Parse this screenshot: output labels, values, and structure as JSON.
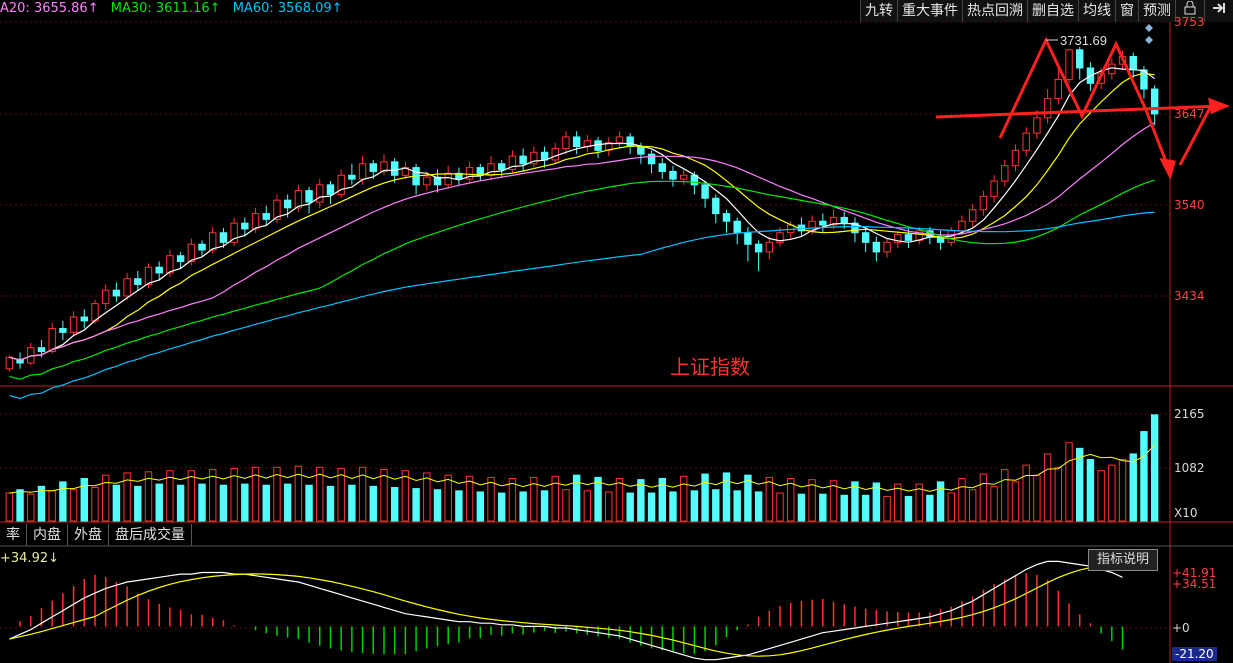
{
  "ma_legend": {
    "ma20": "A20: 3655.86↑",
    "ma30": "MA30: 3611.16↑",
    "ma60": "MA60: 3568.09↑"
  },
  "toolbar": {
    "items": [
      "九转",
      "重大事件",
      "热点回溯",
      "删自选",
      "均线",
      "窗",
      "预测"
    ]
  },
  "title": "上证指数",
  "peak_label": "3731.69",
  "tabs": [
    "率",
    "内盘",
    "外盘",
    "盘后成交量"
  ],
  "macd_value": "+34.92↓",
  "indicator_button": "指标说明",
  "axes": {
    "price_ticks": [
      "3753",
      "3647",
      "3540",
      "3434"
    ],
    "volume_ticks": [
      "2165",
      "1082",
      "X10"
    ],
    "macd_ticks": [
      "+41.91",
      "+34.51",
      "+0",
      "-21.20"
    ]
  },
  "colors": {
    "up": "#ff3232",
    "down": "#54fcfc",
    "ma5": "#ffffff",
    "ma10": "#ffff00",
    "ma20": "#ff80ff",
    "ma30": "#00e600",
    "ma60": "#00c0ff"
  },
  "chart_data": {
    "type": "candlestick",
    "y_range": [
      3380,
      3760
    ],
    "volume_range": [
      0,
      2165
    ],
    "macd_range": [
      -21.2,
      41.91
    ],
    "candles": [
      [
        3398,
        3410,
        3395,
        3412
      ],
      [
        3408,
        3404,
        3398,
        3415
      ],
      [
        3404,
        3420,
        3402,
        3425
      ],
      [
        3420,
        3416,
        3410,
        3428
      ],
      [
        3416,
        3440,
        3414,
        3446
      ],
      [
        3440,
        3436,
        3428,
        3448
      ],
      [
        3436,
        3452,
        3432,
        3458
      ],
      [
        3452,
        3448,
        3440,
        3460
      ],
      [
        3448,
        3466,
        3445,
        3470
      ],
      [
        3466,
        3480,
        3460,
        3486
      ],
      [
        3480,
        3474,
        3468,
        3488
      ],
      [
        3474,
        3492,
        3470,
        3498
      ],
      [
        3492,
        3486,
        3480,
        3500
      ],
      [
        3486,
        3504,
        3482,
        3508
      ],
      [
        3504,
        3498,
        3490,
        3510
      ],
      [
        3498,
        3516,
        3494,
        3522
      ],
      [
        3516,
        3510,
        3502,
        3520
      ],
      [
        3510,
        3528,
        3506,
        3534
      ],
      [
        3528,
        3522,
        3516,
        3532
      ],
      [
        3522,
        3540,
        3518,
        3546
      ],
      [
        3540,
        3530,
        3524,
        3545
      ],
      [
        3530,
        3550,
        3526,
        3556
      ],
      [
        3550,
        3544,
        3536,
        3556
      ],
      [
        3544,
        3560,
        3540,
        3566
      ],
      [
        3560,
        3554,
        3548,
        3568
      ],
      [
        3554,
        3574,
        3550,
        3580
      ],
      [
        3574,
        3566,
        3556,
        3580
      ],
      [
        3566,
        3584,
        3562,
        3590
      ],
      [
        3584,
        3572,
        3560,
        3588
      ],
      [
        3572,
        3590,
        3566,
        3596
      ],
      [
        3590,
        3580,
        3570,
        3594
      ],
      [
        3580,
        3600,
        3576,
        3606
      ],
      [
        3600,
        3596,
        3590,
        3612
      ],
      [
        3596,
        3612,
        3590,
        3620
      ],
      [
        3612,
        3604,
        3596,
        3616
      ],
      [
        3604,
        3614,
        3600,
        3622
      ],
      [
        3614,
        3600,
        3592,
        3618
      ],
      [
        3600,
        3608,
        3596,
        3614
      ],
      [
        3608,
        3590,
        3580,
        3612
      ],
      [
        3590,
        3598,
        3584,
        3604
      ],
      [
        3598,
        3590,
        3582,
        3606
      ],
      [
        3590,
        3602,
        3586,
        3610
      ],
      [
        3602,
        3596,
        3590,
        3608
      ],
      [
        3596,
        3608,
        3592,
        3614
      ],
      [
        3608,
        3600,
        3594,
        3612
      ],
      [
        3600,
        3612,
        3596,
        3620
      ],
      [
        3612,
        3606,
        3598,
        3616
      ],
      [
        3606,
        3620,
        3602,
        3626
      ],
      [
        3620,
        3612,
        3604,
        3628
      ],
      [
        3612,
        3624,
        3608,
        3630
      ],
      [
        3624,
        3616,
        3608,
        3630
      ],
      [
        3616,
        3628,
        3612,
        3634
      ],
      [
        3628,
        3640,
        3622,
        3646
      ],
      [
        3640,
        3630,
        3622,
        3646
      ],
      [
        3630,
        3636,
        3624,
        3642
      ],
      [
        3636,
        3626,
        3618,
        3640
      ],
      [
        3626,
        3634,
        3620,
        3640
      ],
      [
        3634,
        3640,
        3628,
        3646
      ],
      [
        3640,
        3630,
        3622,
        3644
      ],
      [
        3630,
        3622,
        3612,
        3634
      ],
      [
        3622,
        3612,
        3602,
        3626
      ],
      [
        3612,
        3604,
        3596,
        3618
      ],
      [
        3604,
        3596,
        3588,
        3610
      ],
      [
        3596,
        3600,
        3590,
        3606
      ],
      [
        3600,
        3590,
        3580,
        3604
      ],
      [
        3590,
        3576,
        3566,
        3594
      ],
      [
        3576,
        3560,
        3550,
        3580
      ],
      [
        3560,
        3552,
        3540,
        3564
      ],
      [
        3552,
        3540,
        3528,
        3556
      ],
      [
        3540,
        3528,
        3510,
        3546
      ],
      [
        3528,
        3520,
        3500,
        3532
      ],
      [
        3520,
        3530,
        3512,
        3536
      ],
      [
        3530,
        3540,
        3526,
        3546
      ],
      [
        3540,
        3548,
        3534,
        3552
      ],
      [
        3548,
        3542,
        3536,
        3556
      ],
      [
        3542,
        3552,
        3538,
        3558
      ],
      [
        3552,
        3548,
        3540,
        3560
      ],
      [
        3548,
        3556,
        3544,
        3564
      ],
      [
        3556,
        3550,
        3544,
        3562
      ],
      [
        3550,
        3540,
        3530,
        3556
      ],
      [
        3540,
        3530,
        3520,
        3546
      ],
      [
        3530,
        3520,
        3510,
        3536
      ],
      [
        3520,
        3530,
        3514,
        3534
      ],
      [
        3530,
        3538,
        3524,
        3542
      ],
      [
        3538,
        3532,
        3524,
        3544
      ],
      [
        3532,
        3542,
        3528,
        3546
      ],
      [
        3542,
        3536,
        3528,
        3546
      ],
      [
        3536,
        3530,
        3522,
        3542
      ],
      [
        3530,
        3542,
        3526,
        3546
      ],
      [
        3542,
        3552,
        3538,
        3558
      ],
      [
        3552,
        3564,
        3546,
        3570
      ],
      [
        3564,
        3578,
        3558,
        3584
      ],
      [
        3578,
        3594,
        3572,
        3600
      ],
      [
        3594,
        3610,
        3588,
        3616
      ],
      [
        3610,
        3626,
        3604,
        3632
      ],
      [
        3626,
        3644,
        3620,
        3650
      ],
      [
        3644,
        3660,
        3638,
        3668
      ],
      [
        3660,
        3680,
        3654,
        3690
      ],
      [
        3680,
        3700,
        3674,
        3712
      ],
      [
        3700,
        3731,
        3696,
        3732
      ],
      [
        3731,
        3712,
        3700,
        3734
      ],
      [
        3712,
        3696,
        3688,
        3718
      ],
      [
        3696,
        3706,
        3690,
        3712
      ],
      [
        3706,
        3716,
        3700,
        3722
      ],
      [
        3716,
        3724,
        3710,
        3730
      ],
      [
        3724,
        3710,
        3702,
        3728
      ],
      [
        3710,
        3690,
        3680,
        3714
      ],
      [
        3690,
        3664,
        3652,
        3694
      ]
    ],
    "volumes": [
      500,
      560,
      480,
      620,
      540,
      700,
      560,
      760,
      600,
      820,
      640,
      860,
      620,
      880,
      660,
      900,
      640,
      900,
      660,
      920,
      640,
      940,
      660,
      960,
      640,
      960,
      660,
      980,
      640,
      960,
      620,
      940,
      640,
      960,
      620,
      920,
      600,
      900,
      580,
      860,
      560,
      820,
      540,
      800,
      520,
      780,
      500,
      760,
      520,
      780,
      540,
      800,
      560,
      820,
      540,
      780,
      520,
      760,
      500,
      740,
      500,
      760,
      520,
      800,
      540,
      840,
      560,
      860,
      540,
      820,
      520,
      780,
      500,
      760,
      480,
      740,
      480,
      720,
      460,
      700,
      460,
      680,
      440,
      660,
      440,
      660,
      460,
      700,
      500,
      760,
      560,
      840,
      620,
      920,
      700,
      1000,
      820,
      1200,
      960,
      1400,
      1300,
      1100,
      900,
      1000,
      1100,
      1200,
      1600,
      1900
    ],
    "macd_dif": [
      -8,
      -5,
      -2,
      2,
      6,
      10,
      14,
      18,
      21,
      24,
      26,
      28,
      29,
      30,
      31,
      32,
      33,
      33,
      34,
      34,
      34,
      33,
      33,
      32,
      31,
      30,
      29,
      28,
      26,
      24,
      22,
      20,
      18,
      16,
      14,
      12,
      10,
      8,
      7,
      6,
      5,
      4,
      3,
      3,
      2,
      2,
      1,
      1,
      0,
      0,
      0,
      -1,
      -1,
      -2,
      -3,
      -4,
      -5,
      -6,
      -8,
      -10,
      -12,
      -14,
      -16,
      -18,
      -20,
      -21,
      -21,
      -20,
      -19,
      -18,
      -16,
      -14,
      -12,
      -10,
      -8,
      -6,
      -4,
      -3,
      -2,
      -1,
      0,
      1,
      2,
      3,
      4,
      5,
      6,
      8,
      10,
      13,
      16,
      20,
      24,
      28,
      32,
      36,
      39,
      41,
      41,
      40,
      39,
      38,
      36,
      34,
      31
    ]
  }
}
